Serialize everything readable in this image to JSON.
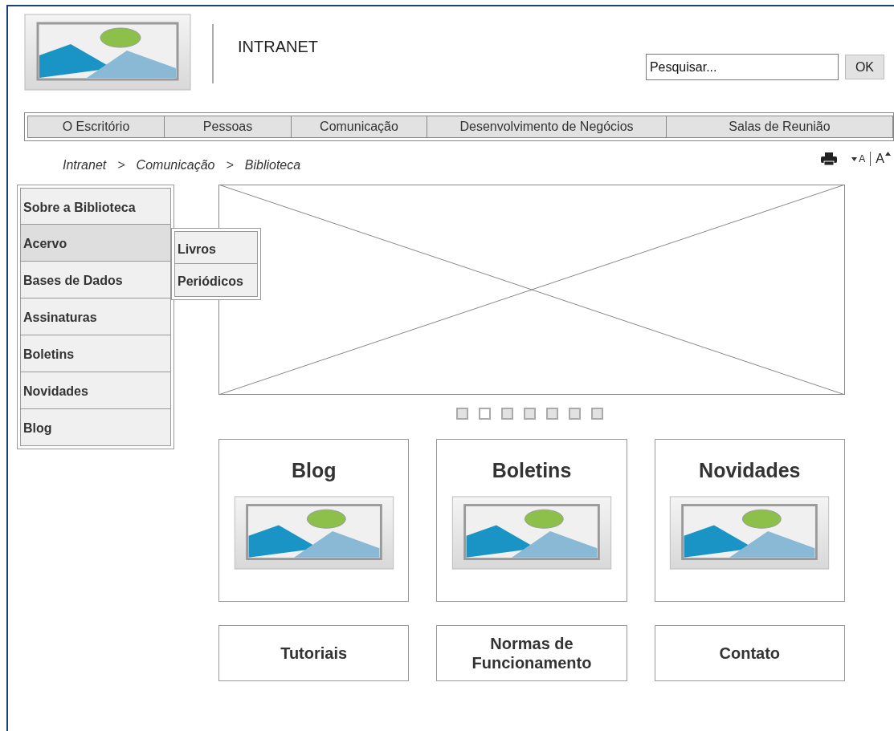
{
  "header": {
    "title": "INTRANET",
    "search": {
      "placeholder": "Pesquisar..."
    },
    "search_button": "OK"
  },
  "nav": [
    {
      "label": "O Escritório"
    },
    {
      "label": "Pessoas"
    },
    {
      "label": "Comunicação"
    },
    {
      "label": "Desenvolvimento de Negócios"
    },
    {
      "label": "Salas de Reunião"
    }
  ],
  "breadcrumb": [
    {
      "kind": "link",
      "text": "Intranet"
    },
    {
      "kind": "separator",
      "text": ">"
    },
    {
      "kind": "link",
      "text": "Comunicação"
    },
    {
      "kind": "separator",
      "text": ">"
    },
    {
      "kind": "link",
      "text": "Biblioteca"
    }
  ],
  "text_size": {
    "decrease": "A",
    "increase": "A"
  },
  "sidebar": [
    {
      "label": "Sobre a Biblioteca",
      "selected": false
    },
    {
      "label": "Acervo",
      "selected": true,
      "expanded": true,
      "children": [
        {
          "label": "Livros"
        },
        {
          "label": "Periódicos"
        }
      ]
    },
    {
      "label": "Bases de Dados",
      "selected": false
    },
    {
      "label": "Assinaturas",
      "selected": false
    },
    {
      "label": "Boletins",
      "selected": false
    },
    {
      "label": "Novidades",
      "selected": false
    },
    {
      "label": "Blog",
      "selected": false
    }
  ],
  "carousel": {
    "dots": [
      {
        "selected": false
      },
      {
        "selected": true
      },
      {
        "selected": false
      },
      {
        "selected": false
      },
      {
        "selected": false
      },
      {
        "selected": false
      },
      {
        "selected": false
      }
    ]
  },
  "cards": [
    {
      "title": "Blog"
    },
    {
      "title": "Boletins"
    },
    {
      "title": "Novidades"
    }
  ],
  "links": [
    {
      "label": "Tutoriais"
    },
    {
      "label": "Normas de Funcionamento"
    },
    {
      "label": "Contato"
    }
  ]
}
